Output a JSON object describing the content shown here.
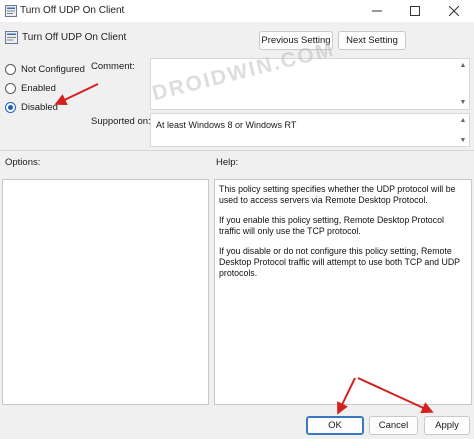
{
  "window": {
    "title": "Turn Off UDP On Client"
  },
  "header": {
    "policy_name": "Turn Off UDP On Client",
    "previous_label": "Previous Setting",
    "next_label": "Next Setting"
  },
  "state": {
    "options": [
      "Not Configured",
      "Enabled",
      "Disabled"
    ],
    "selected": "Disabled"
  },
  "comment": {
    "label": "Comment:",
    "value": ""
  },
  "supported": {
    "label": "Supported on:",
    "value": "At least Windows 8 or Windows RT"
  },
  "options_panel": {
    "label": "Options:"
  },
  "help": {
    "label": "Help:",
    "paragraphs": [
      "This policy setting specifies whether the UDP protocol will be used to access servers via Remote Desktop Protocol.",
      "If you enable this policy setting, Remote Desktop Protocol traffic will only use the TCP protocol.",
      "If you disable or do not configure this policy setting, Remote Desktop Protocol traffic will attempt to use both TCP and UDP protocols."
    ]
  },
  "footer": {
    "ok_label": "OK",
    "cancel_label": "Cancel",
    "apply_label": "Apply"
  },
  "watermark": "DROIDWIN.COM",
  "colors": {
    "accent": "#1f5fbf",
    "annotation": "#d42020"
  }
}
